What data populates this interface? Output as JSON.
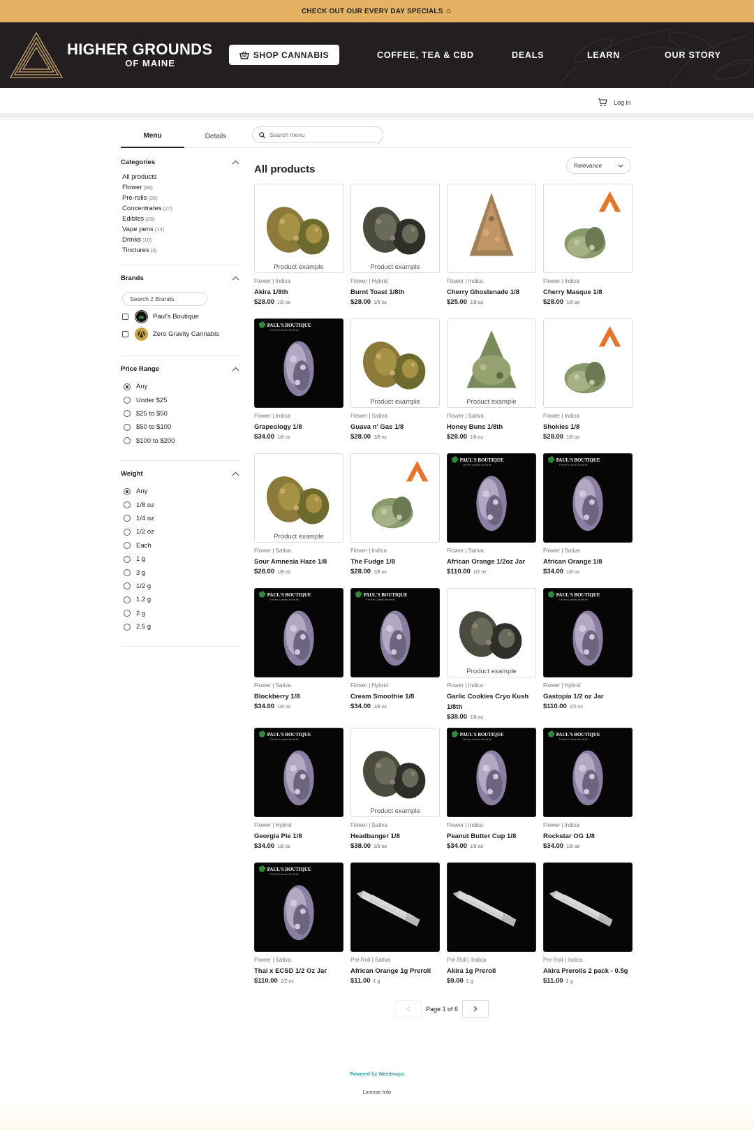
{
  "promo": {
    "text": "CHECK OUT OUR EVERY DAY SPECIALS ☺"
  },
  "header": {
    "logo_main": "HIGHER GROUNDS",
    "logo_sub": "OF MAINE",
    "shop_label": "SHOP CANNABIS",
    "nav": [
      "COFFEE, TEA & CBD",
      "DEALS",
      "LEARN",
      "OUR STORY"
    ]
  },
  "subbar": {
    "login_label": "Log in"
  },
  "tabs": {
    "menu": "Menu",
    "details": "Details"
  },
  "search": {
    "placeholder": "Search menu"
  },
  "sidebar": {
    "categories": {
      "title": "Categories",
      "items": [
        {
          "label": "All products",
          "count": ""
        },
        {
          "label": "Flower",
          "count": "(56)"
        },
        {
          "label": "Pre-rolls",
          "count": "(35)"
        },
        {
          "label": "Concentrates",
          "count": "(27)"
        },
        {
          "label": "Edibles",
          "count": "(26)"
        },
        {
          "label": "Vape pens",
          "count": "(13)"
        },
        {
          "label": "Drinks",
          "count": "(10)"
        },
        {
          "label": "Tinctures",
          "count": "(3)"
        }
      ]
    },
    "brands": {
      "title": "Brands",
      "search_label": "Search 2 Brands",
      "items": [
        "Paul's Boutique",
        "Zero Gravity Cannabis"
      ]
    },
    "price": {
      "title": "Price Range",
      "options": [
        "Any",
        "Under $25",
        "$25 to $50",
        "$50 to $100",
        "$100 to $200"
      ],
      "selected": "Any"
    },
    "weight": {
      "title": "Weight",
      "options": [
        "Any",
        "1/8 oz",
        "1/4 oz",
        "1/2 oz",
        "Each",
        "1 g",
        "3 g",
        "1/2 g",
        "1.2 g",
        "2 g",
        "2.5 g"
      ],
      "selected": "Any"
    }
  },
  "products_section": {
    "title": "All products",
    "sort_label": "Relevance"
  },
  "example_label": "Product example",
  "products": [
    {
      "type": "Flower | Indica",
      "name": "Akira 1/8th",
      "price": "$28.00",
      "weight": "1/8 oz",
      "image": "bud-photo",
      "example": true
    },
    {
      "type": "Flower | Hybrid",
      "name": "Burnt Toast 1/8th",
      "price": "$28.00",
      "weight": "1/8 oz",
      "image": "bud-dark-photo",
      "example": true
    },
    {
      "type": "Flower | Indica",
      "name": "Cherry Ghostenade 1/8",
      "price": "$25.00",
      "weight": "1/8 oz",
      "image": "bud-orange-photo",
      "example": false
    },
    {
      "type": "Flower | Indica",
      "name": "Cherry Masque 1/8",
      "price": "$28.00",
      "weight": "1/8 oz",
      "image": "zero-gravity-bud",
      "example": false
    },
    {
      "type": "Flower | Indica",
      "name": "Grapeology 1/8",
      "price": "$34.00",
      "weight": "1/8 oz",
      "image": "pauls-boutique-bud",
      "example": false
    },
    {
      "type": "Flower | Sativa",
      "name": "Guava n' Gas 1/8",
      "price": "$28.00",
      "weight": "1/8 oz",
      "image": "bud-photo",
      "example": true
    },
    {
      "type": "Flower | Sativa",
      "name": "Honey Buns 1/8th",
      "price": "$28.00",
      "weight": "1/8 oz",
      "image": "bud-green-photo",
      "example": true
    },
    {
      "type": "Flower | Indica",
      "name": "Shokies 1/8",
      "price": "$28.00",
      "weight": "1/8 oz",
      "image": "zero-gravity-bud",
      "example": false
    },
    {
      "type": "Flower | Sativa",
      "name": "Sour Amnesia Haze 1/8",
      "price": "$28.00",
      "weight": "1/8 oz",
      "image": "bud-photo",
      "example": true
    },
    {
      "type": "Flower | Indica",
      "name": "The Fudge 1/8",
      "price": "$28.00",
      "weight": "1/8 oz",
      "image": "zero-gravity-bud",
      "example": false
    },
    {
      "type": "Flower | Sativa",
      "name": "African Orange 1/2oz Jar",
      "price": "$110.00",
      "weight": "1/2 oz",
      "image": "pauls-boutique-bud",
      "example": false
    },
    {
      "type": "Flower | Sativa",
      "name": "African Orange 1/8",
      "price": "$34.00",
      "weight": "1/8 oz",
      "image": "pauls-boutique-bud",
      "example": false
    },
    {
      "type": "Flower | Sativa",
      "name": "Blockberry 1/8",
      "price": "$34.00",
      "weight": "1/8 oz",
      "image": "pauls-boutique-bud",
      "example": false
    },
    {
      "type": "Flower | Hybrid",
      "name": "Cream Smoothie 1/8",
      "price": "$34.00",
      "weight": "1/8 oz",
      "image": "pauls-boutique-bud",
      "example": false
    },
    {
      "type": "Flower | Indica",
      "name": "Garlic Cookies Cryo Kush 1/8th",
      "price": "$38.00",
      "weight": "1/8 oz",
      "image": "bud-dark-photo",
      "example": true
    },
    {
      "type": "Flower | Hybrid",
      "name": "Gastopia 1/2 oz Jar",
      "price": "$110.00",
      "weight": "1/2 oz",
      "image": "pauls-boutique-bud",
      "example": false
    },
    {
      "type": "Flower | Hybrid",
      "name": "Georgia Pie 1/8",
      "price": "$34.00",
      "weight": "1/8 oz",
      "image": "pauls-boutique-bud",
      "example": false
    },
    {
      "type": "Flower | Sativa",
      "name": "Headbanger 1/8",
      "price": "$38.00",
      "weight": "1/8 oz",
      "image": "bud-dark-photo",
      "example": true
    },
    {
      "type": "Flower | Indica",
      "name": "Peanut Butter Cup 1/8",
      "price": "$34.00",
      "weight": "1/8 oz",
      "image": "pauls-boutique-bud",
      "example": false
    },
    {
      "type": "Flower | Indica",
      "name": "Rockstar OG 1/8",
      "price": "$34.00",
      "weight": "1/8 oz",
      "image": "pauls-boutique-bud",
      "example": false
    },
    {
      "type": "Flower | Sativa",
      "name": "Thai x ECSD 1/2 Oz Jar",
      "price": "$110.00",
      "weight": "1/2 oz",
      "image": "pauls-boutique-bud",
      "example": false
    },
    {
      "type": "Pre Roll | Sativa",
      "name": "African Orange 1g Preroll",
      "price": "$11.00",
      "weight": "1 g",
      "image": "preroll-photo",
      "example": false
    },
    {
      "type": "Pre Roll | Indica",
      "name": "Akira 1g Preroll",
      "price": "$9.00",
      "weight": "1 g",
      "image": "preroll-photo",
      "example": false
    },
    {
      "type": "Pre Roll | Indica",
      "name": "Akira Prerolls 2 pack - 0.5g",
      "price": "$11.00",
      "weight": "1 g",
      "image": "preroll-photo",
      "example": false
    }
  ],
  "pagination": {
    "label": "Page 1 of 6"
  },
  "footer": {
    "powered": "Powered by Weedmaps",
    "license": "License Info"
  },
  "colors": {
    "promo_bg": "#e3b262",
    "nav_bg": "#231f20",
    "accent": "#2aa5a3",
    "zero_gravity": "#e8742a"
  }
}
